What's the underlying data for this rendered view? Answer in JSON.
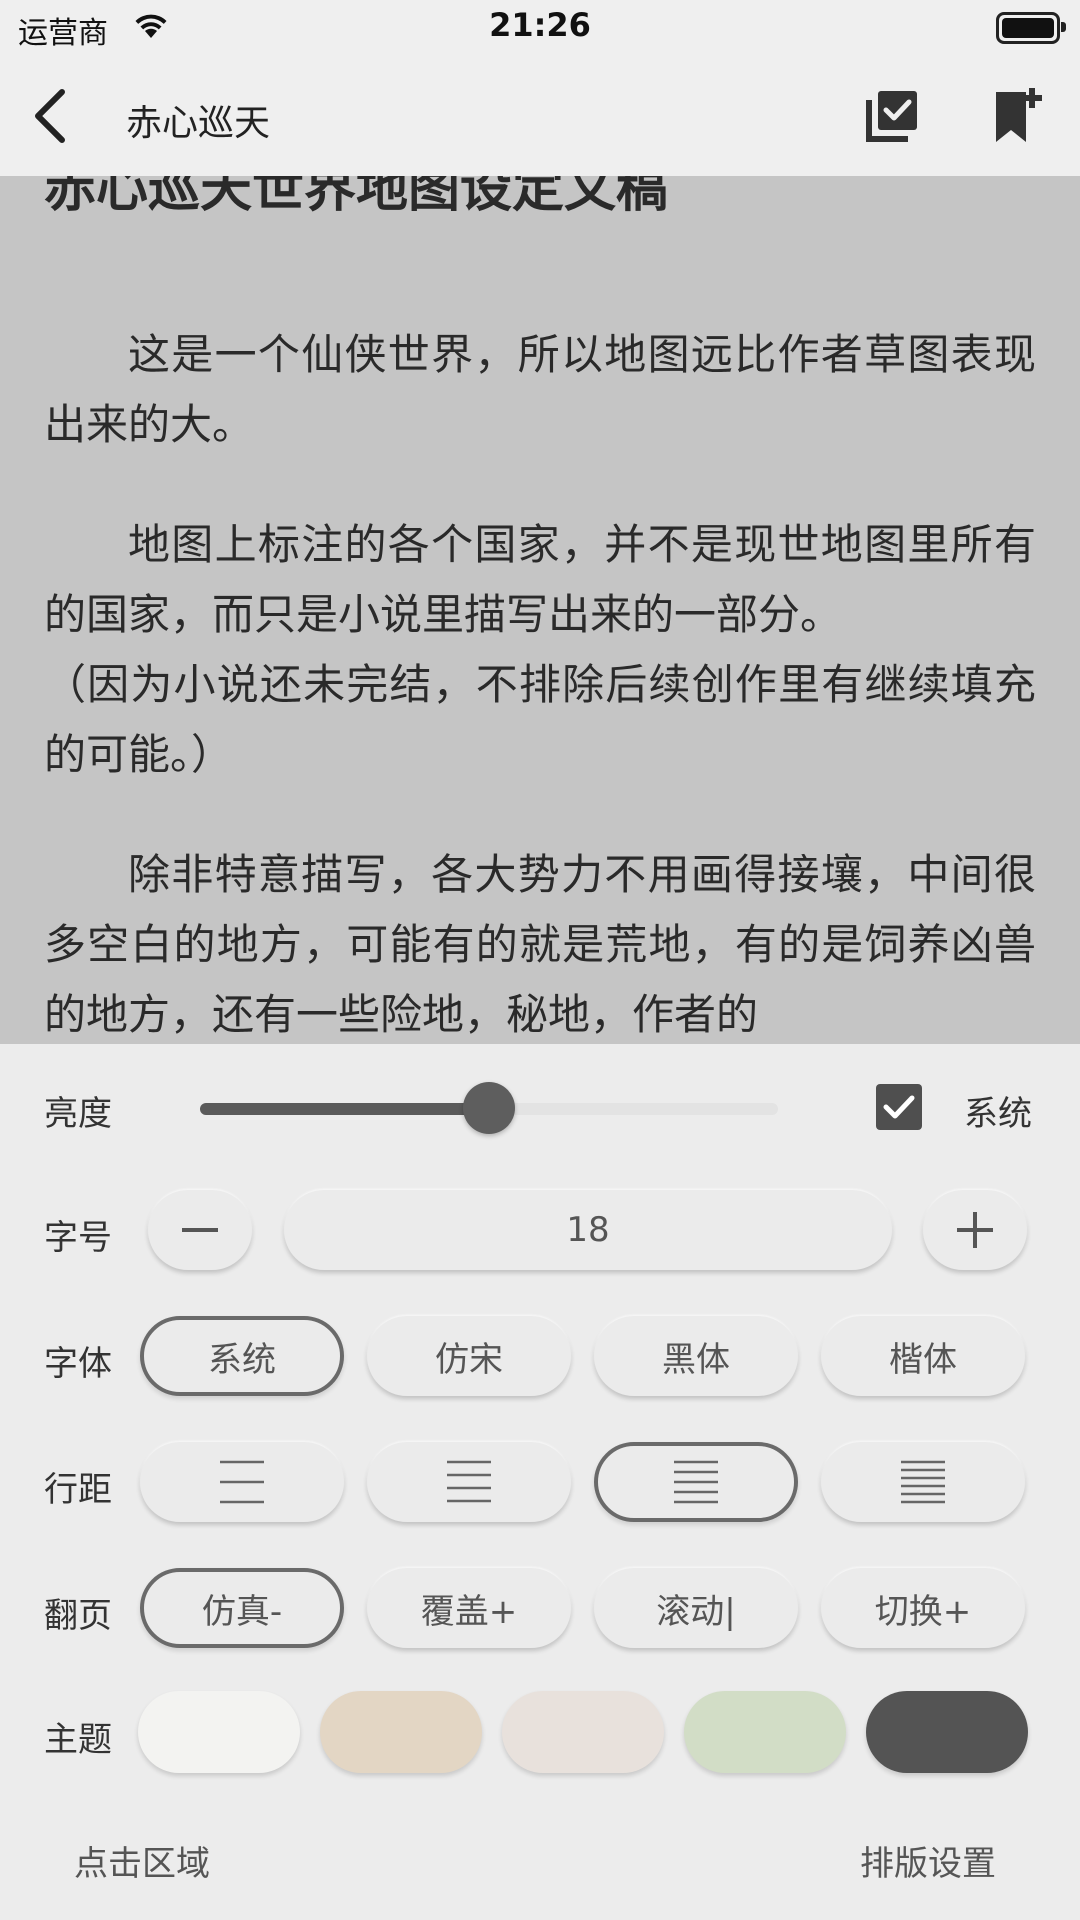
{
  "status_bar": {
    "carrier": "运营商",
    "time": "21:26"
  },
  "nav": {
    "title": "赤心巡天",
    "icons": [
      "back-chevron-icon",
      "checklist-icon",
      "bookmark-add-icon"
    ]
  },
  "reader": {
    "chapter_title": "赤心巡天世界地图设定文稿",
    "paragraphs": [
      "这是一个仙侠世界，所以地图远比作者草图表现出来的大。",
      "地图上标注的各个国家，并不是现世地图里所有的国家，而只是小说里描写出来的一部分。",
      "（因为小说还未完结，不排除后续创作里有继续填充的可能。）",
      "除非特意描写，各大势力不用画得接壤，中间很多空白的地方，可能有的就是荒地，有的是饲养凶兽的地方，还有一些险地，秘地，作者的"
    ]
  },
  "settings": {
    "brightness": {
      "label": "亮度",
      "value": 0.5,
      "system_label": "系统",
      "system_checked": true
    },
    "font_size": {
      "label": "字号",
      "value": "18"
    },
    "font_family": {
      "label": "字体",
      "options": [
        "系统",
        "仿宋",
        "黑体",
        "楷体"
      ],
      "selected": 0
    },
    "line_spacing": {
      "label": "行距",
      "options": [
        3,
        4,
        5,
        6
      ],
      "selected": 2
    },
    "page_turn": {
      "label": "翻页",
      "options": [
        "仿真-",
        "覆盖+",
        "滚动|",
        "切换+"
      ],
      "selected": 0
    },
    "theme": {
      "label": "主题",
      "colors": [
        "#f3f3f1",
        "#e3d6c4",
        "#e8e1dc",
        "#d2ddc6",
        "#545454"
      ]
    },
    "footer": {
      "tap_area": "点击区域",
      "layout_settings": "排版设置"
    }
  }
}
